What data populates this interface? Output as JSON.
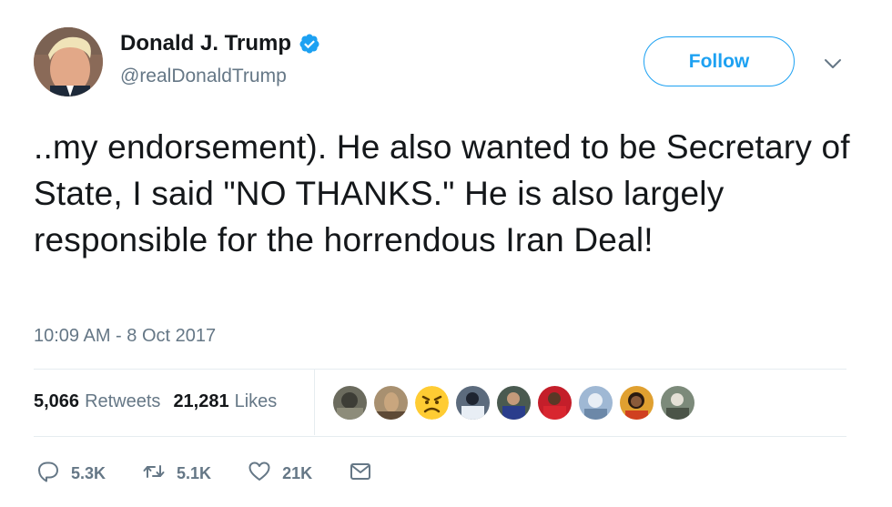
{
  "author": {
    "name": "Donald J. Trump",
    "handle": "@realDonaldTrump",
    "verified_icon": "verified-badge-icon"
  },
  "follow_label": "Follow",
  "tweet": {
    "text": "..my endorsement). He also wanted to be Secretary of State, I said \"NO THANKS.\" He is also largely responsible for the horrendous Iran Deal!",
    "timestamp": "10:09 AM - 8 Oct 2017"
  },
  "stats": {
    "retweets_count": "5,066",
    "retweets_label": "Retweets",
    "likes_count": "21,281",
    "likes_label": "Likes"
  },
  "actions": {
    "reply_count": "5.3K",
    "retweet_count": "5.1K",
    "like_count": "21K"
  },
  "colors": {
    "accent": "#1da1f2",
    "muted": "#657786",
    "text": "#14171a",
    "divider": "#e6ecf0"
  }
}
